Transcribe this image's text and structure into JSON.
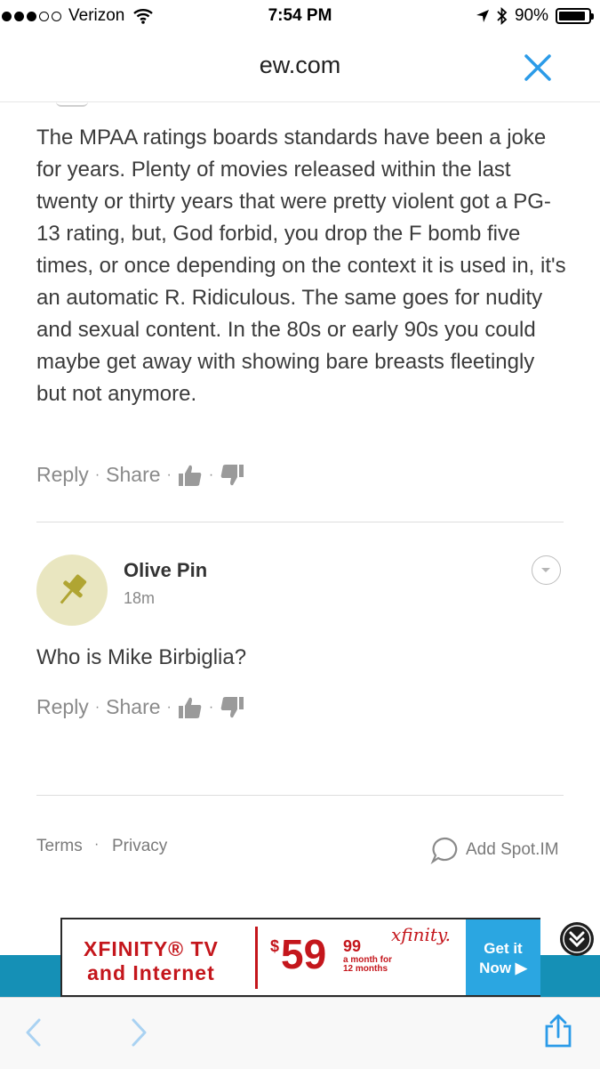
{
  "status_bar": {
    "carrier": "Verizon",
    "time": "7:54 PM",
    "battery": "90%",
    "battery_level": 0.9,
    "signal_bars_filled": 3,
    "signal_bars_total": 5,
    "icons": [
      "wifi-icon",
      "location-arrow-icon",
      "bluetooth-icon",
      "battery-icon"
    ]
  },
  "browser": {
    "title": "ew.com",
    "close_icon": "close-icon",
    "accent_color": "#2b9be8"
  },
  "comments": [
    {
      "text": "The MPAA ratings boards standards have been a joke for years. Plenty of movies released within the last twenty or thirty years that were pretty violent got a PG-13 rating, but, God forbid, you drop the F bomb five times, or once depending on the context it is used in, it's an automatic R. Ridiculous. The same goes for nudity and sexual content. In the 80s or early 90s you could maybe get away with showing bare breasts fleetingly but not anymore.",
      "reply_label": "Reply",
      "share_label": "Share"
    },
    {
      "author": "Olive Pin",
      "time_ago": "18m",
      "avatar_icon": "pushpin-icon",
      "text": "Who is Mike Birbiglia?",
      "reply_label": "Reply",
      "share_label": "Share"
    }
  ],
  "footer": {
    "terms_label": "Terms",
    "privacy_label": "Privacy",
    "add_spotim_label": "Add Spot.IM"
  },
  "ad": {
    "headline_line1": "XFINITY® TV",
    "headline_line2": "and Internet",
    "price_symbol": "$",
    "price_whole": "59",
    "price_cents": "99",
    "fine_print_line1": "a month for",
    "fine_print_line2": "12 months",
    "brand": "xfinity.",
    "cta_line1": "Get it",
    "cta_line2": "Now ▶",
    "brand_color": "#c4161c",
    "cta_color": "#2ba6e1",
    "strip_color": "#1590b6"
  },
  "toolbar": {
    "icons": [
      "back-chevron-icon",
      "forward-chevron-icon",
      "share-icon"
    ]
  }
}
